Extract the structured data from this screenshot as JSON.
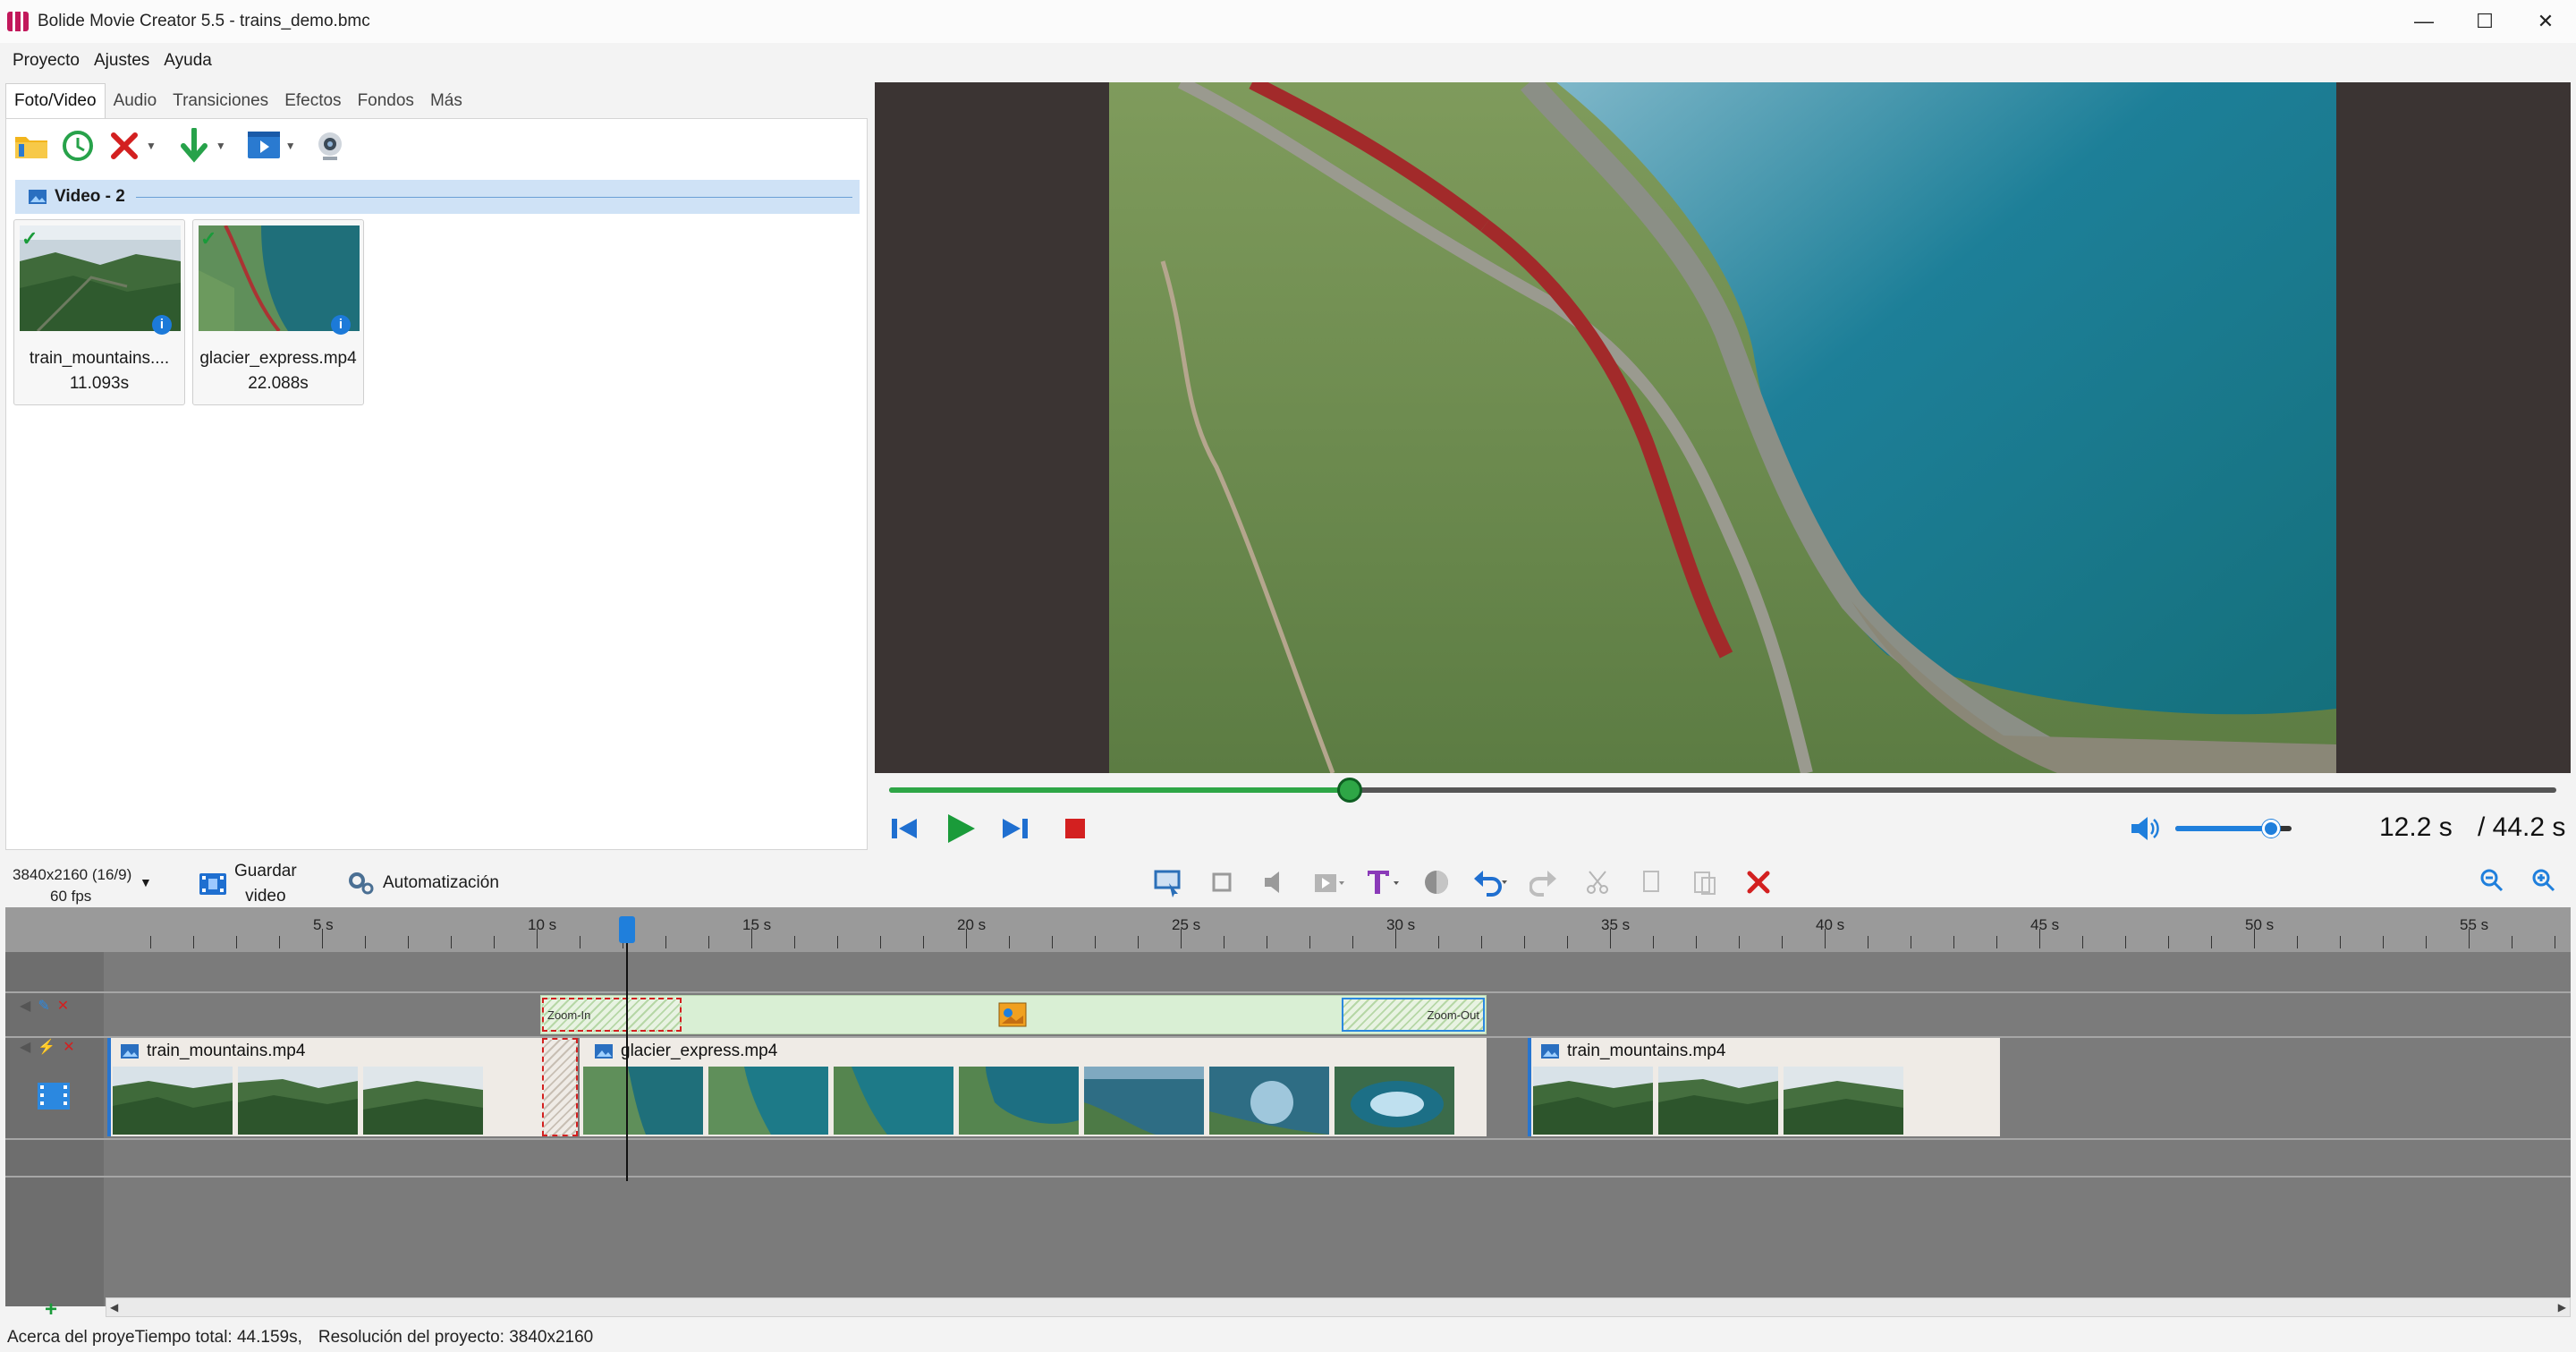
{
  "window": {
    "title": "Bolide Movie Creator 5.5 - trains_demo.bmc",
    "minimize": "—",
    "maximize": "☐",
    "close": "✕"
  },
  "menu": [
    "Proyecto",
    "Ajustes",
    "Ayuda"
  ],
  "tabs": [
    "Foto/Video",
    "Audio",
    "Transiciones",
    "Efectos",
    "Fondos",
    "Más"
  ],
  "library": {
    "group_label": "Video - 2",
    "items": [
      {
        "name": "train_mountains....",
        "duration": "11.093s"
      },
      {
        "name": "glacier_express.mp4",
        "duration": "22.088s"
      }
    ]
  },
  "player": {
    "progress_fraction": 0.2765,
    "volume_fraction": 0.82,
    "current_time": "12.2 s",
    "total_time": "/ 44.2 s"
  },
  "project": {
    "resolution_label": "3840x2160 (16/9)",
    "fps_label": "60 fps",
    "save_label_line1": "Guardar",
    "save_label_line2": "video",
    "automation_label": "Automatización"
  },
  "timeline": {
    "ruler_labels": [
      "5 s",
      "10 s",
      "15 s",
      "20 s",
      "25 s",
      "30 s",
      "35 s",
      "40 s",
      "45 s",
      "50 s",
      "55 s"
    ],
    "zoom_in_label": "Zoom-In",
    "zoom_out_label": "Zoom-Out",
    "clips": [
      {
        "name": "train_mountains.mp4"
      },
      {
        "name": "glacier_express.mp4"
      },
      {
        "name": "train_mountains.mp4"
      }
    ]
  },
  "status": {
    "about": "Acerca del proye",
    "total_time": "Tiempo total: 44.159s,",
    "resolution": "Resolución del proyecto:  3840x2160"
  },
  "colors": {
    "accent_green": "#2ea646",
    "accent_blue": "#1f7fdc",
    "delete_red": "#d32020"
  }
}
